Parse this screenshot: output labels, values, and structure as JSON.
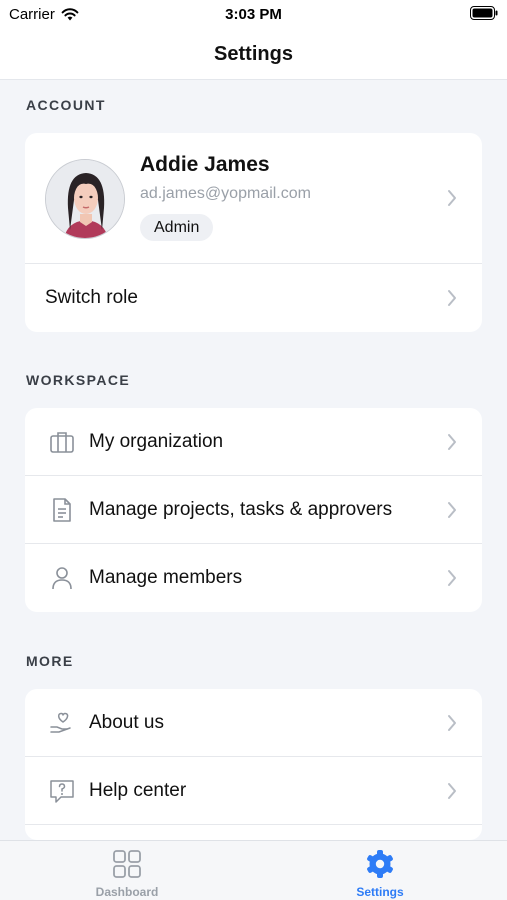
{
  "status_bar": {
    "carrier": "Carrier",
    "time": "3:03 PM"
  },
  "nav": {
    "title": "Settings"
  },
  "account": {
    "header": "ACCOUNT",
    "profile": {
      "name": "Addie James",
      "email": "ad.james@yopmail.com",
      "role": "Admin"
    },
    "switch_role": "Switch role"
  },
  "workspace": {
    "header": "WORKSPACE",
    "items": [
      {
        "label": "My organization",
        "icon": "briefcase-icon"
      },
      {
        "label": "Manage projects, tasks & approvers",
        "icon": "document-icon"
      },
      {
        "label": "Manage members",
        "icon": "person-icon"
      }
    ]
  },
  "more": {
    "header": "MORE",
    "items": [
      {
        "label": "About us",
        "icon": "heart-hand-icon"
      },
      {
        "label": "Help center",
        "icon": "help-bubble-icon"
      }
    ]
  },
  "tabs": [
    {
      "label": "Dashboard",
      "icon": "grid-icon",
      "active": false
    },
    {
      "label": "Settings",
      "icon": "gear-icon",
      "active": true
    }
  ],
  "colors": {
    "accent": "#2e7cf6",
    "background": "#f3f5f9",
    "card": "#ffffff",
    "muted": "#9aa0a8"
  }
}
